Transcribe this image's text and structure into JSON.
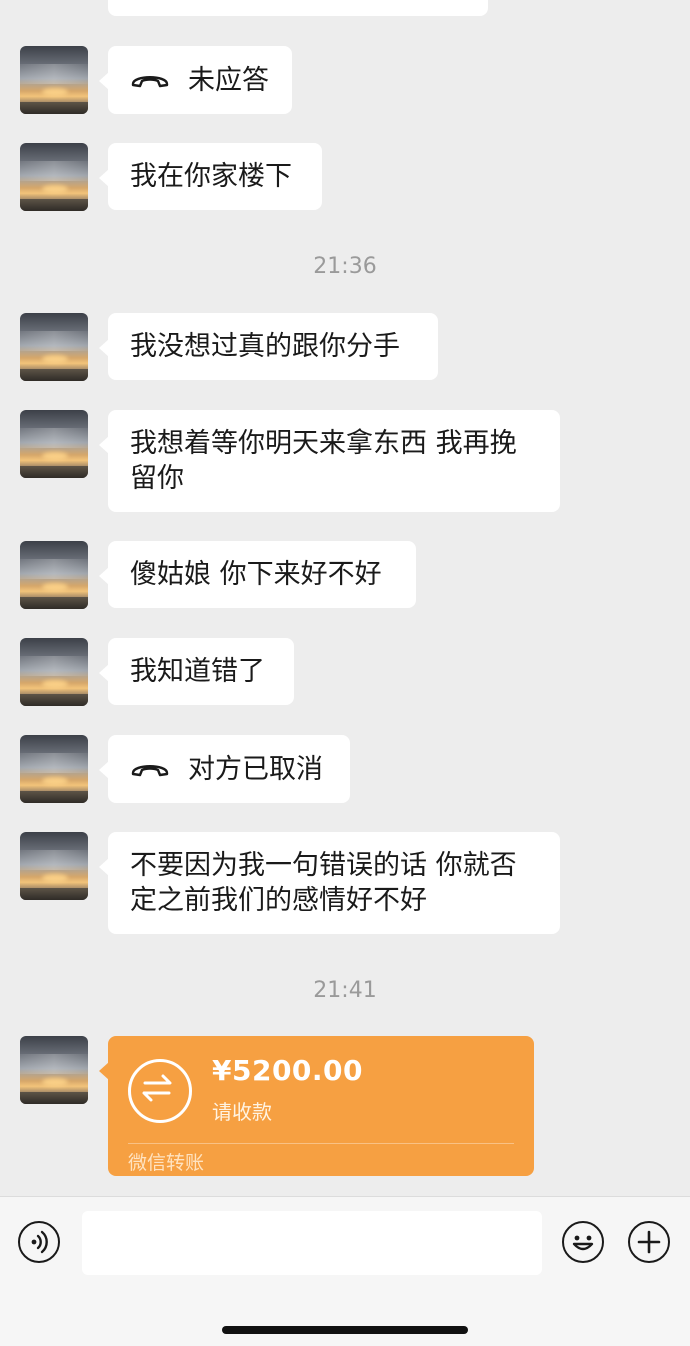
{
  "messages": {
    "missed_call": "未应答",
    "m1": "我在你家楼下",
    "time1": "21:36",
    "m2": "我没想过真的跟你分手",
    "m3": "我想着等你明天来拿东西 我再挽留你",
    "m4": "傻姑娘 你下来好不好",
    "m5": "我知道错了",
    "cancelled_call": "对方已取消",
    "m6": "不要因为我一句错误的话 你就否定之前我们的感情好不好",
    "time2": "21:41"
  },
  "transfer": {
    "amount": "¥5200.00",
    "status": "请收款",
    "footer": "微信转账",
    "color": "#f6a042"
  },
  "input": {
    "voice_icon": "voice-icon",
    "emoji_icon": "emoji-icon",
    "plus_icon": "plus-icon",
    "placeholder": ""
  }
}
